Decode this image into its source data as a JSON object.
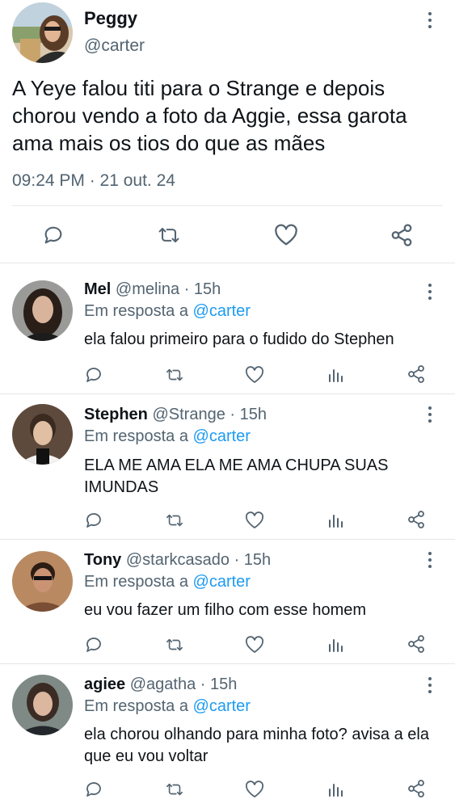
{
  "main_tweet": {
    "name": "Peggy",
    "handle": "@carter",
    "text": "A Yeye falou titi para o Strange e depois chorou vendo a foto da Aggie, essa garota ama mais os tios do que as mães",
    "timestamp": "09:24 PM · 21 out. 24",
    "actions": [
      "reply-icon",
      "retweet-icon",
      "like-icon",
      "share-icon"
    ]
  },
  "reply_prefix": "Em resposta a",
  "reply_to": "@carter",
  "replies": [
    {
      "name": "Mel",
      "handle": "@melina",
      "time": "· 15h",
      "text": "ela falou primeiro para o fudido do Stephen"
    },
    {
      "name": "Stephen",
      "handle": "@Strange",
      "time": "· 15h",
      "text": "ELA ME AMA ELA ME AMA CHUPA SUAS IMUNDAS"
    },
    {
      "name": "Tony",
      "handle": "@starkcasado",
      "time": "· 15h",
      "text": "eu vou fazer um filho com esse homem"
    },
    {
      "name": "agiee",
      "handle": "@agatha",
      "time": "· 15h",
      "text": "ela chorou olhando para minha foto? avisa a ela que eu vou voltar"
    }
  ],
  "colors": {
    "text": "#0f1419",
    "secondary": "#536471",
    "accent": "#1d9bf0",
    "divider": "#e7e9ea"
  }
}
